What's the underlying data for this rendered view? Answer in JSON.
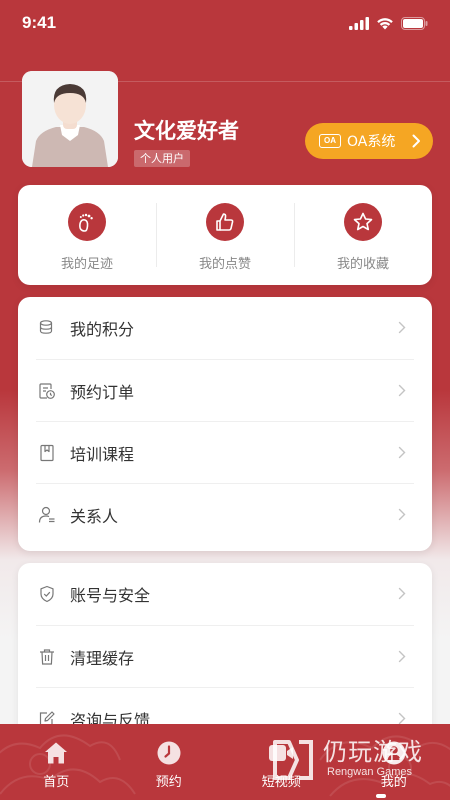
{
  "status_bar": {
    "time": "9:41"
  },
  "profile": {
    "name": "文化爱好者",
    "tag": "个人用户",
    "oa_button": {
      "badge": "OA",
      "label": "OA系统"
    }
  },
  "quick_actions": [
    {
      "label": "我的足迹",
      "icon": "footprint-icon"
    },
    {
      "label": "我的点赞",
      "icon": "thumbs-up-icon"
    },
    {
      "label": "我的收藏",
      "icon": "star-icon"
    }
  ],
  "menu_group_1": [
    {
      "label": "我的积分",
      "icon": "coins-icon"
    },
    {
      "label": "预约订单",
      "icon": "order-clock-icon"
    },
    {
      "label": "培训课程",
      "icon": "book-icon"
    },
    {
      "label": "关系人",
      "icon": "contact-icon"
    }
  ],
  "menu_group_2": [
    {
      "label": "账号与安全",
      "icon": "shield-icon"
    },
    {
      "label": "清理缓存",
      "icon": "trash-icon"
    },
    {
      "label": "咨询与反馈",
      "icon": "feedback-icon"
    }
  ],
  "tabbar": [
    {
      "label": "首页",
      "icon": "home-icon"
    },
    {
      "label": "预约",
      "icon": "clock-icon"
    },
    {
      "label": "短视频",
      "icon": "video-icon"
    },
    {
      "label": "我的",
      "icon": "user-icon"
    }
  ],
  "watermark": {
    "cn": "仍玩游戏",
    "en": "Rengwan Games"
  },
  "colors": {
    "primary": "#b9373c",
    "accent": "#f5a623",
    "text": "#333333",
    "muted": "#888888"
  }
}
